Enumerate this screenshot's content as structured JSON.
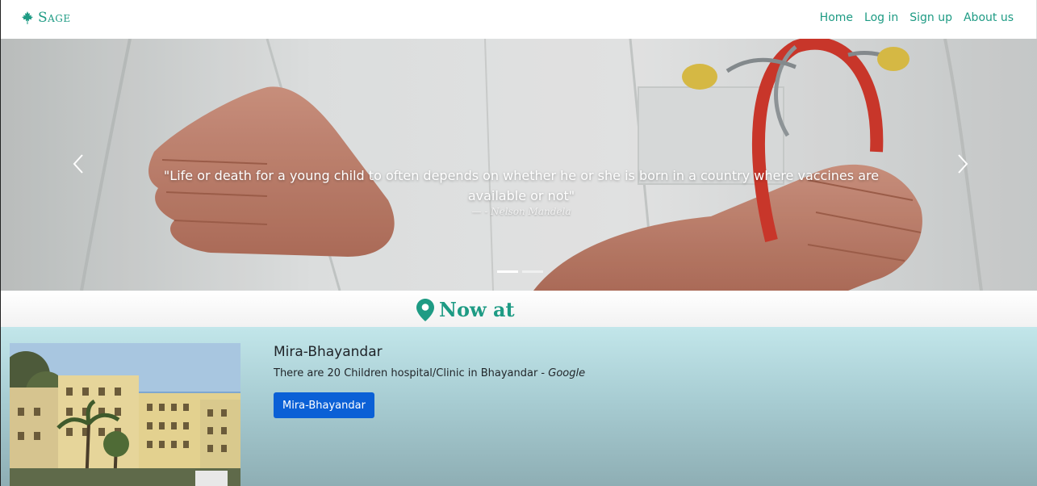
{
  "navbar": {
    "brand": "Sage",
    "brand_icon": "maple-leaf-icon",
    "links": [
      "Home",
      "Log in",
      "Sign up",
      "About us"
    ],
    "accent_color": "#1e9b84"
  },
  "carousel": {
    "quote": "\"Life or death for a young child to often depends on whether he or she is born in a country where vaccines are available or not\"",
    "author": "— - Nelson Mandela",
    "slides_count": 2,
    "active_slide": 1,
    "prev_icon": "chevron-left-icon",
    "next_icon": "chevron-right-icon"
  },
  "now_at": {
    "heading": "Now at",
    "icon": "map-pin-icon"
  },
  "location": {
    "title": "Mira-Bhayandar",
    "description": "There are 20 Children hospital/Clinic in Bhayandar - ",
    "source": "Google",
    "button_label": "Mira-Bhayandar",
    "button_color": "#0b60d6"
  }
}
